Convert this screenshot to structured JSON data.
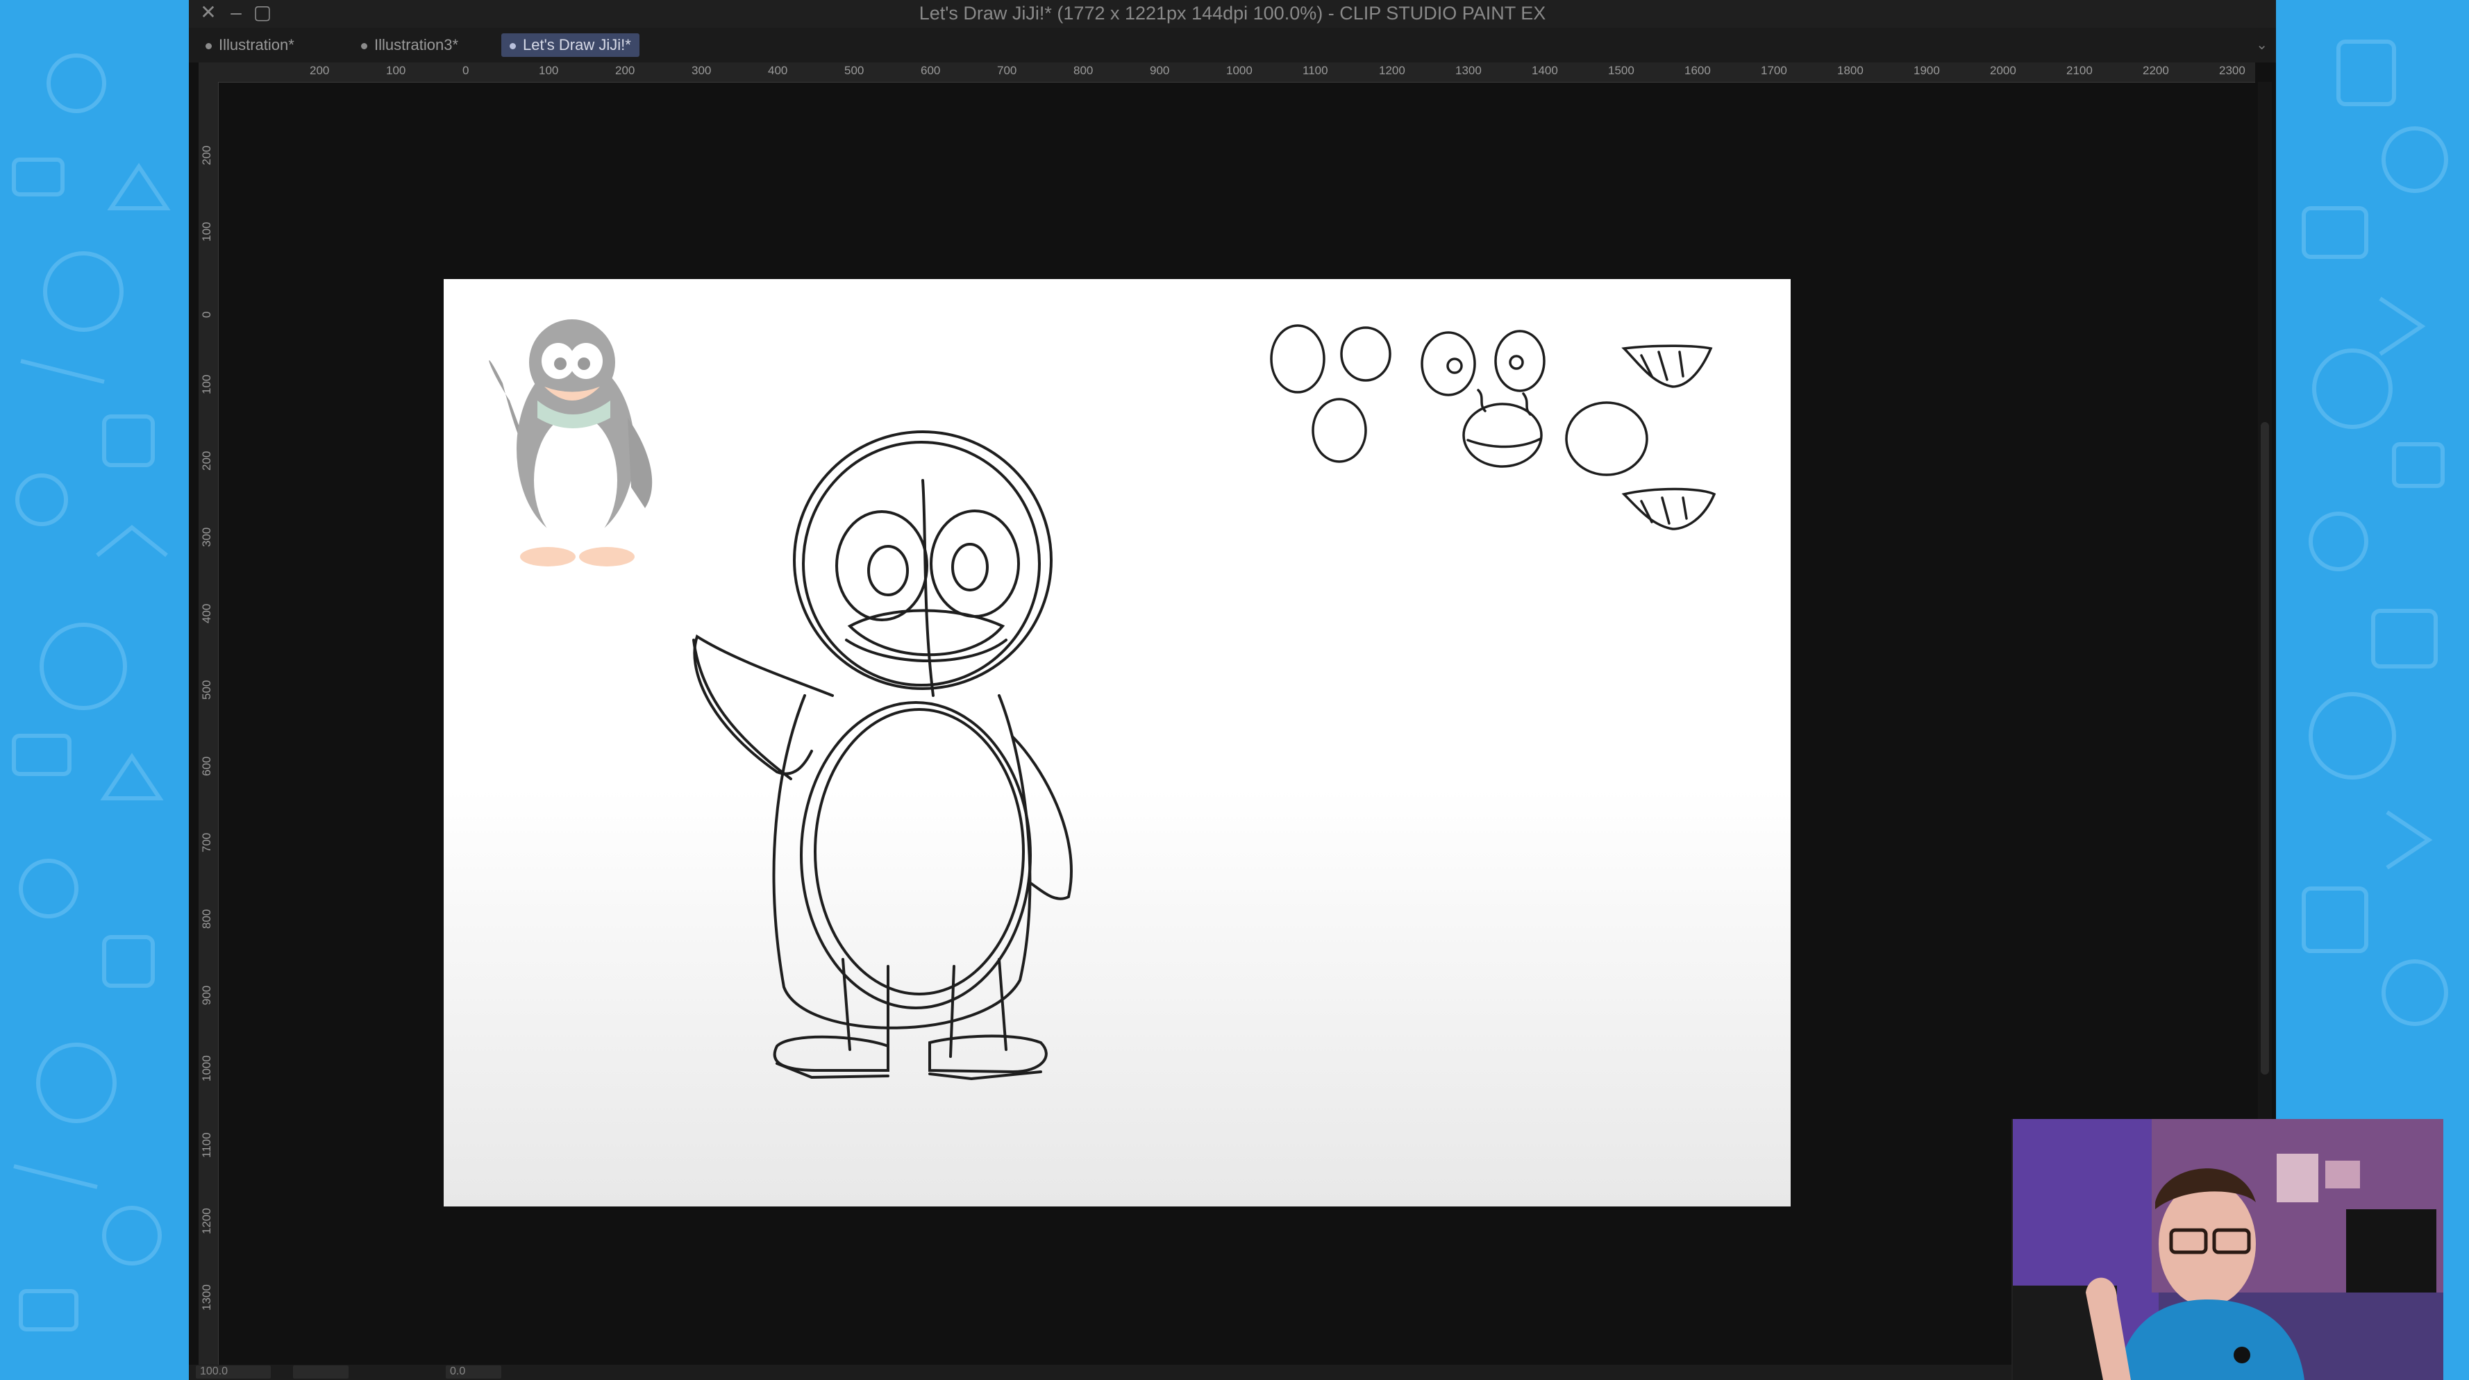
{
  "window": {
    "title": "Let's Draw JiJi!* (1772 x 1221px 144dpi 100.0%)  - CLIP STUDIO PAINT EX",
    "close_glyph": "✕",
    "minimize_glyph": "–",
    "maximize_glyph": "▢"
  },
  "tabs": [
    {
      "label": "Illustration*"
    },
    {
      "label": "Illustration3*"
    },
    {
      "label": "Let's Draw JiJi!*",
      "active": true
    }
  ],
  "ruler": {
    "horizontal": [
      "200",
      "100",
      "0",
      "100",
      "200",
      "300",
      "400",
      "500",
      "600",
      "700",
      "800",
      "900",
      "1000",
      "1100",
      "1200",
      "1300",
      "1400",
      "1500",
      "1600",
      "1700",
      "1800",
      "1900",
      "2000",
      "2100",
      "2200",
      "2300"
    ],
    "vertical": [
      "200",
      "100",
      "0",
      "100",
      "200",
      "300",
      "400",
      "500",
      "600",
      "700",
      "800",
      "900",
      "1000",
      "1100",
      "1200",
      "1300"
    ]
  },
  "statusbar": {
    "zoom": "100.0",
    "angle": "0.0"
  },
  "colors": {
    "backdrop": "#31a6ea",
    "window_bg": "#111111",
    "active_tab": "#3d4868",
    "canvas": "#ffffff"
  },
  "icons": {
    "close": "close-icon",
    "minimize": "minimize-icon",
    "maximize": "maximize-icon"
  }
}
